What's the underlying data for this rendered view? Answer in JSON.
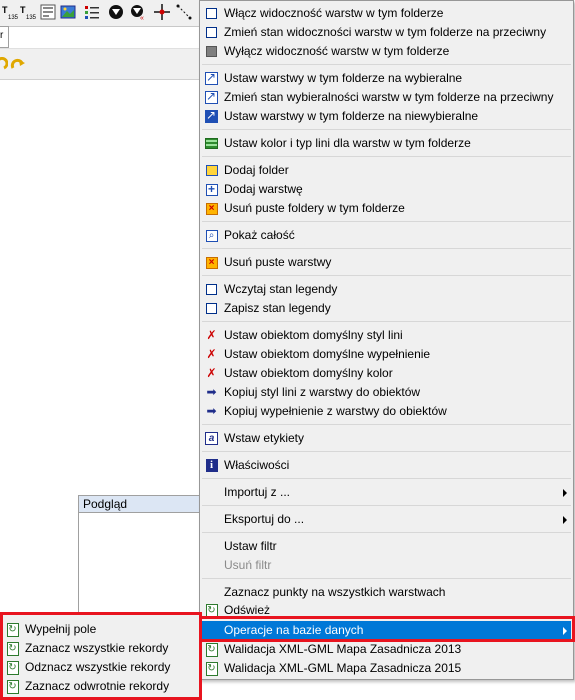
{
  "toolbar": {
    "icons": [
      "table-properties-icon",
      "text-size-icon",
      "picture-icon",
      "list-icon",
      "layer-filter-icon",
      "symbol-icon",
      "crosshair-icon",
      "measure-line-icon"
    ],
    "small_labels": [
      "T",
      "135",
      "T",
      "135"
    ]
  },
  "tab_stub": {
    "label": "r"
  },
  "preview": {
    "title": "Podgląd"
  },
  "context_menu": {
    "items": [
      {
        "label": "Włącz widoczność warstw w tym folderze",
        "icon": "checkbox-empty-icon"
      },
      {
        "label": "Zmień stan widoczności warstw w tym folderze na przeciwny",
        "icon": "checkbox-empty-icon"
      },
      {
        "label": "Wyłącz widoczność warstw w tym folderze",
        "icon": "checkbox-gray-icon"
      },
      {
        "label": "Ustaw warstwy w tym folderze na wybieralne",
        "icon": "selectable-arrow-icon"
      },
      {
        "label": "Zmień stan wybieralności warstw w tym folderze na przeciwny",
        "icon": "selectable-arrow-icon"
      },
      {
        "label": "Ustaw warstwy w tym folderze na niewybieralne",
        "icon": "selectable-arrow-dark-icon"
      },
      {
        "label": "Ustaw kolor i typ lini dla warstw w tym folderze",
        "icon": "line-style-icon"
      },
      {
        "label": "Dodaj folder",
        "icon": "folder-icon"
      },
      {
        "label": "Dodaj warstwę",
        "icon": "plus-icon"
      },
      {
        "label": "Usuń puste foldery w tym folderze",
        "icon": "delete-icon"
      },
      {
        "label": "Pokaż całość",
        "icon": "zoom-icon"
      },
      {
        "label": "Usuń puste warstwy",
        "icon": "delete-icon"
      },
      {
        "label": "Wczytaj stan legendy",
        "icon": "checkbox-empty-icon"
      },
      {
        "label": "Zapisz stan legendy",
        "icon": "checkbox-empty-icon"
      },
      {
        "label": "Ustaw obiektom domyślny styl lini",
        "icon": "style-reset-icon"
      },
      {
        "label": "Ustaw obiektom domyślne wypełnienie",
        "icon": "style-reset-icon"
      },
      {
        "label": "Ustaw obiektom domyślny kolor",
        "icon": "style-reset-icon"
      },
      {
        "label": "Kopiuj styl lini z warstwy do obiektów",
        "icon": "copy-style-icon"
      },
      {
        "label": "Kopiuj wypełnienie z warstwy do obiektów",
        "icon": "copy-style-icon"
      },
      {
        "label": "Wstaw etykiety",
        "icon": "label-icon"
      },
      {
        "label": "Właściwości",
        "icon": "info-icon"
      },
      {
        "label": "Importuj z ...",
        "icon": ""
      },
      {
        "label": "Eksportuj do ...",
        "icon": ""
      },
      {
        "label": "Ustaw filtr",
        "icon": ""
      },
      {
        "label": "Usuń filtr",
        "icon": ""
      },
      {
        "label": "Zaznacz punkty na wszystkich warstwach",
        "icon": ""
      },
      {
        "label": "Odśwież",
        "icon": "refresh-icon"
      },
      {
        "label": "Operacje na bazie danych",
        "icon": ""
      },
      {
        "label": "Walidacja XML-GML Mapa Zasadnicza 2013",
        "icon": "refresh-icon"
      },
      {
        "label": "Walidacja XML-GML Mapa Zasadnicza 2015",
        "icon": "refresh-icon"
      }
    ]
  },
  "sub_menu": {
    "items": [
      {
        "label": "Wypełnij pole",
        "icon": "refresh-icon"
      },
      {
        "label": "Zaznacz wszystkie rekordy",
        "icon": "refresh-icon"
      },
      {
        "label": "Odznacz wszystkie rekordy",
        "icon": "refresh-icon"
      },
      {
        "label": "Zaznacz odwrotnie rekordy",
        "icon": "refresh-icon"
      }
    ]
  },
  "colors": {
    "highlight": "#0078d7",
    "annotation_frame": "#e8141f",
    "menu_background": "#f0f0f0"
  }
}
